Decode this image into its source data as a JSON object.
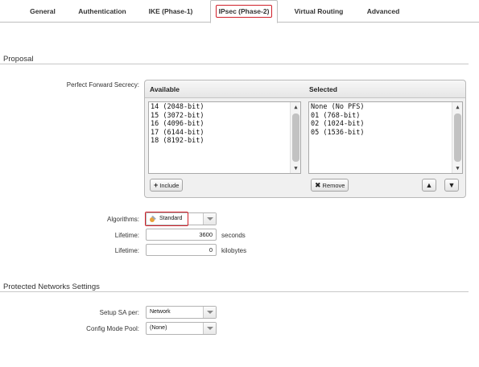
{
  "tabs": [
    {
      "label": "General",
      "active": false
    },
    {
      "label": "Authentication",
      "active": false
    },
    {
      "label": "IKE (Phase-1)",
      "active": false
    },
    {
      "label": "IPsec (Phase-2)",
      "active": true
    },
    {
      "label": "Virtual Routing",
      "active": false
    },
    {
      "label": "Advanced",
      "active": false
    }
  ],
  "proposal": {
    "section_title": "Proposal",
    "pfs_label": "Perfect Forward Secrecy:",
    "available_header": "Available",
    "selected_header": "Selected",
    "available_items": [
      "14 (2048-bit)",
      "15 (3072-bit)",
      "16 (4096-bit)",
      "17 (6144-bit)",
      "18 (8192-bit)"
    ],
    "selected_items": [
      "None (No PFS)",
      "01 (768-bit)",
      "02 (1024-bit)",
      "05 (1536-bit)"
    ],
    "include_label": "Include",
    "remove_label": "Remove",
    "algorithms_label": "Algorithms:",
    "algorithms_value": "Standard",
    "lifetime_seconds_label": "Lifetime:",
    "lifetime_seconds_value": "3600",
    "lifetime_seconds_unit": "seconds",
    "lifetime_kb_label": "Lifetime:",
    "lifetime_kb_value": "0",
    "lifetime_kb_unit": "kilobytes"
  },
  "protected_networks": {
    "section_title": "Protected Networks Settings",
    "setup_sa_label": "Setup SA per:",
    "setup_sa_value": "Network",
    "config_mode_label": "Config Mode Pool:",
    "config_mode_value": "(None)"
  },
  "colors": {
    "highlight": "#d0202a"
  }
}
